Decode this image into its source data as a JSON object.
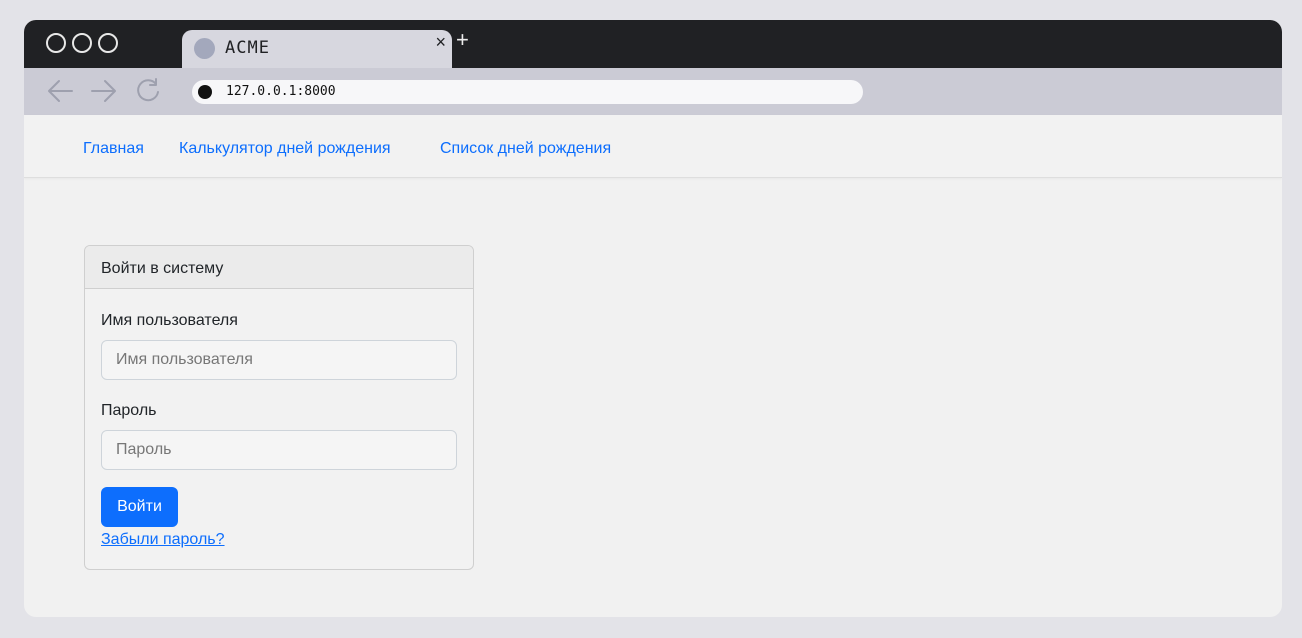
{
  "browser": {
    "tab_title": "ACME",
    "close_glyph": "×",
    "new_tab_glyph": "+",
    "url": "127.0.0.1:8000",
    "icons": [
      "back-arrow-icon",
      "forward-arrow-icon",
      "reload-icon"
    ]
  },
  "navbar": {
    "links": [
      {
        "label": "Главная"
      },
      {
        "label": "Калькулятор дней рождения"
      },
      {
        "label": "Список дней рождения"
      }
    ]
  },
  "login": {
    "header": "Войти в систему",
    "username_label": "Имя пользователя",
    "username_placeholder": "Имя пользователя",
    "password_label": "Пароль",
    "password_placeholder": "Пароль",
    "submit_label": "Войти",
    "forgot_label": "Забыли пароль?"
  },
  "colors": {
    "accent": "#0d6efd",
    "titlebar": "#202124",
    "toolbar": "#cbcbd5"
  }
}
